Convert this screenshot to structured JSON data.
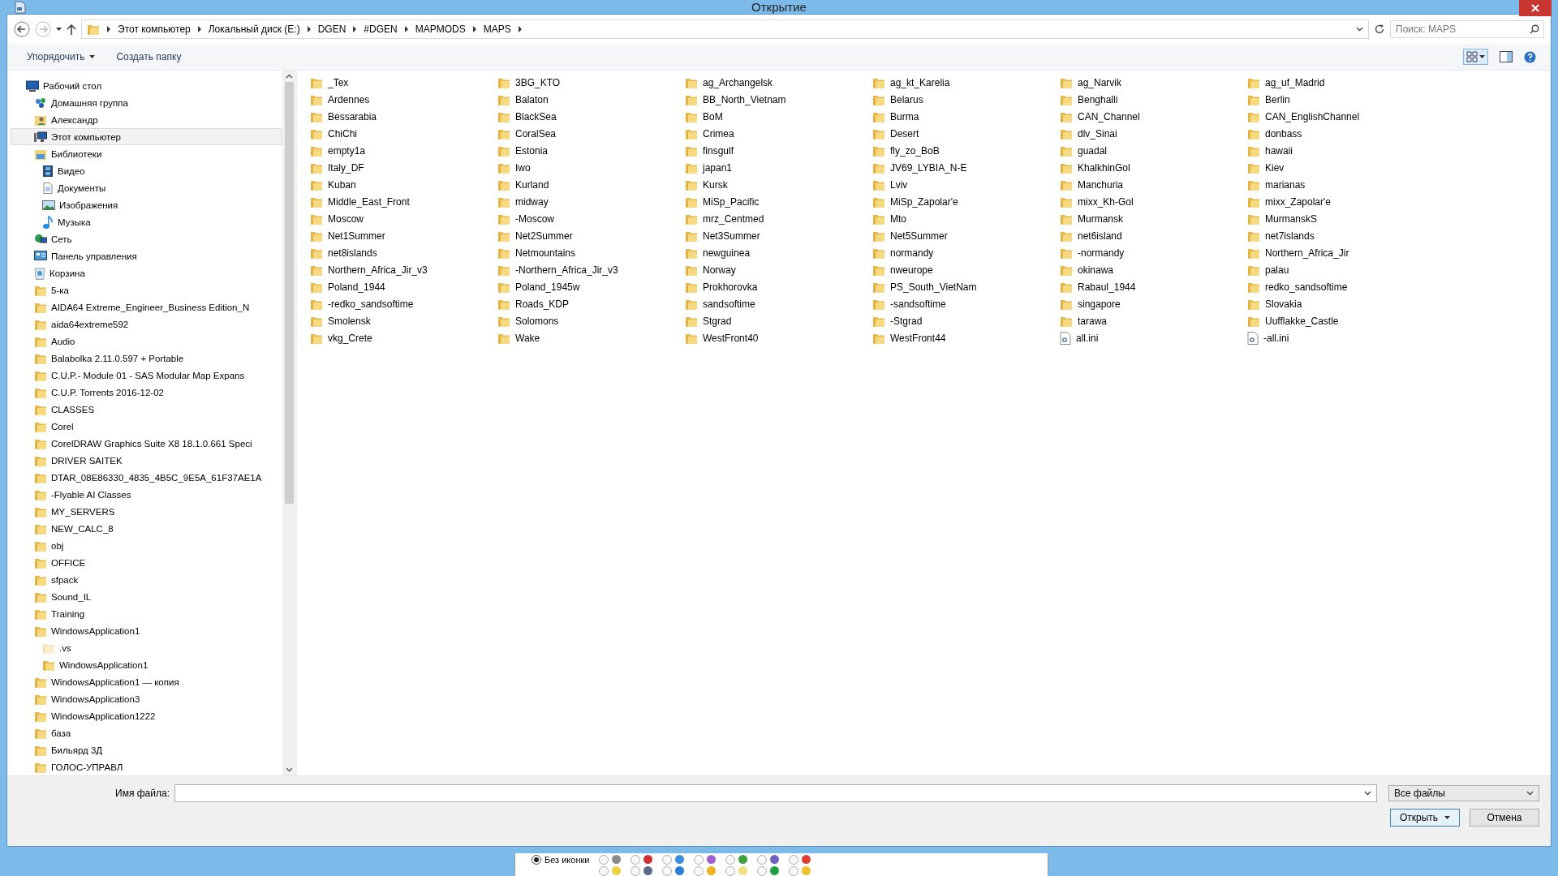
{
  "window": {
    "title": "Открытие"
  },
  "address_bar": {
    "path": [
      "Этот компьютер",
      "Локальный диск (E:)",
      "DGEN",
      "#DGEN",
      "MAPMODS",
      "MAPS"
    ],
    "search": {
      "placeholder": "Поиск: MAPS"
    }
  },
  "toolbar": {
    "buttons": [
      {
        "label": "Упорядочить",
        "kind": "menu"
      },
      {
        "label": "Создать папку",
        "kind": "plain"
      }
    ]
  },
  "sidebar": {
    "items": [
      {
        "label": "Рабочий стол",
        "kind": "desktop",
        "selected": false,
        "children": [
          {
            "label": "Домашняя группа",
            "kind": "homegroup",
            "selected": false
          },
          {
            "label": "Александр",
            "kind": "user",
            "selected": false
          },
          {
            "label": "Этот компьютер",
            "kind": "computer",
            "selected": true
          },
          {
            "label": "Библиотеки",
            "kind": "library",
            "selected": false,
            "children": [
              {
                "label": "Видео",
                "kind": "video",
                "selected": false
              },
              {
                "label": "Документы",
                "kind": "documents",
                "selected": false
              },
              {
                "label": "Изображения",
                "kind": "images",
                "selected": false
              },
              {
                "label": "Музыка",
                "kind": "music",
                "selected": false
              }
            ]
          },
          {
            "label": "Сеть",
            "kind": "network",
            "selected": false
          },
          {
            "label": "Панель управления",
            "kind": "control",
            "selected": false
          },
          {
            "label": "Корзина",
            "kind": "recycle",
            "selected": false
          },
          {
            "label": "5-ка",
            "kind": "folder",
            "selected": false
          },
          {
            "label": "AIDA64 Extreme_Engineer_Business Edition_N",
            "kind": "folder",
            "selected": false
          },
          {
            "label": "aida64extreme592",
            "kind": "folder",
            "selected": false
          },
          {
            "label": "Audio",
            "kind": "folder",
            "selected": false
          },
          {
            "label": "Balabolka 2.11.0.597 + Portable",
            "kind": "folder",
            "selected": false
          },
          {
            "label": "C.U.P.- Module 01 - SAS Modular Map Expans",
            "kind": "folder",
            "selected": false
          },
          {
            "label": "C.U.P. Torrents 2016-12-02",
            "kind": "folder",
            "selected": false
          },
          {
            "label": "CLASSES",
            "kind": "folder",
            "selected": false
          },
          {
            "label": "Corel",
            "kind": "folder",
            "selected": false
          },
          {
            "label": "CorelDRAW Graphics Suite X8 18.1.0.661 Speci",
            "kind": "folder",
            "selected": false
          },
          {
            "label": "DRIVER SAITEK",
            "kind": "folder",
            "selected": false
          },
          {
            "label": "DTAR_08E86330_4835_4B5C_9E5A_61F37AE1A",
            "kind": "folder",
            "selected": false
          },
          {
            "label": "-Flyable AI Classes",
            "kind": "folder",
            "selected": false
          },
          {
            "label": "MY_SERVERS",
            "kind": "folder",
            "selected": false
          },
          {
            "label": "NEW_CALC_8",
            "kind": "folder",
            "selected": false
          },
          {
            "label": "obj",
            "kind": "folder",
            "selected": false
          },
          {
            "label": "OFFICE",
            "kind": "folder",
            "selected": false
          },
          {
            "label": "sfpack",
            "kind": "folder",
            "selected": false
          },
          {
            "label": "Sound_IL",
            "kind": "folder",
            "selected": false
          },
          {
            "label": "Training",
            "kind": "folder",
            "selected": false
          },
          {
            "label": "WindowsApplication1",
            "kind": "folder",
            "selected": false,
            "children": [
              {
                "label": ".vs",
                "kind": "hidden-folder",
                "selected": false
              },
              {
                "label": "WindowsApplication1",
                "kind": "folder",
                "selected": false
              }
            ]
          },
          {
            "label": "WindowsApplication1 — копия",
            "kind": "folder",
            "selected": false
          },
          {
            "label": "WindowsApplication3",
            "kind": "folder",
            "selected": false
          },
          {
            "label": "WindowsApplication1222",
            "kind": "folder",
            "selected": false
          },
          {
            "label": "база",
            "kind": "folder",
            "selected": false
          },
          {
            "label": "Бильярд 3Д",
            "kind": "folder",
            "selected": false
          },
          {
            "label": "ГОЛОС-УПРАВЛ",
            "kind": "folder",
            "selected": false
          }
        ]
      }
    ]
  },
  "files": [
    {
      "name": "_Tex",
      "kind": "folder"
    },
    {
      "name": "Ardennes",
      "kind": "folder"
    },
    {
      "name": "Bessarabia",
      "kind": "folder"
    },
    {
      "name": "ChiChi",
      "kind": "folder"
    },
    {
      "name": "empty1a",
      "kind": "folder"
    },
    {
      "name": "Italy_DF",
      "kind": "folder"
    },
    {
      "name": "Kuban",
      "kind": "folder"
    },
    {
      "name": "Middle_East_Front",
      "kind": "folder"
    },
    {
      "name": "Moscow",
      "kind": "folder"
    },
    {
      "name": "Net1Summer",
      "kind": "folder"
    },
    {
      "name": "net8islands",
      "kind": "folder"
    },
    {
      "name": "Northern_Africa_Jir_v3",
      "kind": "folder"
    },
    {
      "name": "Poland_1944",
      "kind": "folder"
    },
    {
      "name": "-redko_sandsoftime",
      "kind": "folder"
    },
    {
      "name": "Smolensk",
      "kind": "folder"
    },
    {
      "name": "vkg_Crete",
      "kind": "folder"
    },
    {
      "name": "3BG_KTO",
      "kind": "folder"
    },
    {
      "name": "Balaton",
      "kind": "folder"
    },
    {
      "name": "BlackSea",
      "kind": "folder"
    },
    {
      "name": "CoralSea",
      "kind": "folder"
    },
    {
      "name": "Estonia",
      "kind": "folder"
    },
    {
      "name": "Iwo",
      "kind": "folder"
    },
    {
      "name": "Kurland",
      "kind": "folder"
    },
    {
      "name": "midway",
      "kind": "folder"
    },
    {
      "name": "-Moscow",
      "kind": "folder"
    },
    {
      "name": "Net2Summer",
      "kind": "folder"
    },
    {
      "name": "Netmountains",
      "kind": "folder"
    },
    {
      "name": "-Northern_Africa_Jir_v3",
      "kind": "folder"
    },
    {
      "name": "Poland_1945w",
      "kind": "folder"
    },
    {
      "name": "Roads_KDP",
      "kind": "folder"
    },
    {
      "name": "Solomons",
      "kind": "folder"
    },
    {
      "name": "Wake",
      "kind": "folder"
    },
    {
      "name": "ag_Archangelsk",
      "kind": "folder"
    },
    {
      "name": "BB_North_Vietnam",
      "kind": "folder"
    },
    {
      "name": "BoM",
      "kind": "folder"
    },
    {
      "name": "Crimea",
      "kind": "folder"
    },
    {
      "name": "finsgulf",
      "kind": "folder"
    },
    {
      "name": "japan1",
      "kind": "folder"
    },
    {
      "name": "Kursk",
      "kind": "folder"
    },
    {
      "name": "MiSp_Pacific",
      "kind": "folder"
    },
    {
      "name": "mrz_Centmed",
      "kind": "folder"
    },
    {
      "name": "Net3Summer",
      "kind": "folder"
    },
    {
      "name": "newguinea",
      "kind": "folder"
    },
    {
      "name": "Norway",
      "kind": "folder"
    },
    {
      "name": "Prokhorovka",
      "kind": "folder"
    },
    {
      "name": "sandsoftime",
      "kind": "folder"
    },
    {
      "name": "Stgrad",
      "kind": "folder"
    },
    {
      "name": "WestFront40",
      "kind": "folder"
    },
    {
      "name": "ag_kt_Karelia",
      "kind": "folder"
    },
    {
      "name": "Belarus",
      "kind": "folder"
    },
    {
      "name": "Burma",
      "kind": "folder"
    },
    {
      "name": "Desert",
      "kind": "folder"
    },
    {
      "name": "fly_zo_BoB",
      "kind": "folder"
    },
    {
      "name": "JV69_LYBIA_N-E",
      "kind": "folder"
    },
    {
      "name": "Lviv",
      "kind": "folder"
    },
    {
      "name": "MiSp_Zapolar'e",
      "kind": "folder"
    },
    {
      "name": "Mto",
      "kind": "folder"
    },
    {
      "name": "Net5Summer",
      "kind": "folder"
    },
    {
      "name": "normandy",
      "kind": "folder"
    },
    {
      "name": "nweurope",
      "kind": "folder"
    },
    {
      "name": "PS_South_VietNam",
      "kind": "folder"
    },
    {
      "name": "-sandsoftime",
      "kind": "folder"
    },
    {
      "name": "-Stgrad",
      "kind": "folder"
    },
    {
      "name": "WestFront44",
      "kind": "folder"
    },
    {
      "name": "ag_Narvik",
      "kind": "folder"
    },
    {
      "name": "Benghalli",
      "kind": "folder"
    },
    {
      "name": "CAN_Channel",
      "kind": "folder"
    },
    {
      "name": "dlv_Sinai",
      "kind": "folder"
    },
    {
      "name": "guadal",
      "kind": "folder"
    },
    {
      "name": "KhalkhinGol",
      "kind": "folder"
    },
    {
      "name": "Manchuria",
      "kind": "folder"
    },
    {
      "name": "mixx_Kh-Gol",
      "kind": "folder"
    },
    {
      "name": "Murmansk",
      "kind": "folder"
    },
    {
      "name": "net6island",
      "kind": "folder"
    },
    {
      "name": "-normandy",
      "kind": "folder"
    },
    {
      "name": "okinawa",
      "kind": "folder"
    },
    {
      "name": "Rabaul_1944",
      "kind": "folder"
    },
    {
      "name": "singapore",
      "kind": "folder"
    },
    {
      "name": "tarawa",
      "kind": "folder"
    },
    {
      "name": "all.ini",
      "kind": "ini"
    },
    {
      "name": "ag_uf_Madrid",
      "kind": "folder"
    },
    {
      "name": "Berlin",
      "kind": "folder"
    },
    {
      "name": "CAN_EnglishChannel",
      "kind": "folder"
    },
    {
      "name": "donbass",
      "kind": "folder"
    },
    {
      "name": "hawaii",
      "kind": "folder"
    },
    {
      "name": "Kiev",
      "kind": "folder"
    },
    {
      "name": "marianas",
      "kind": "folder"
    },
    {
      "name": "mixx_Zapolar'e",
      "kind": "folder"
    },
    {
      "name": "MurmanskS",
      "kind": "folder"
    },
    {
      "name": "net7islands",
      "kind": "folder"
    },
    {
      "name": "Northern_Africa_Jir",
      "kind": "folder"
    },
    {
      "name": "palau",
      "kind": "folder"
    },
    {
      "name": "redko_sandsoftime",
      "kind": "folder"
    },
    {
      "name": "Slovakia",
      "kind": "folder"
    },
    {
      "name": "Uufflakke_Castle",
      "kind": "folder"
    },
    {
      "name": "-all.ini",
      "kind": "ini"
    }
  ],
  "file_name": {
    "label": "Имя файла:"
  },
  "file_type": {
    "value": "Все файлы"
  },
  "buttons": [
    {
      "label": "Открыть",
      "kind": "split"
    },
    {
      "label": "Отмена",
      "kind": "plain"
    }
  ],
  "background_window": {
    "label": "Без иконки",
    "selected": true,
    "options": [
      {
        "selected": false,
        "color": "#8a8a8a"
      },
      {
        "selected": false,
        "color": "#f0d040"
      },
      {
        "selected": false,
        "color": "#d03030"
      },
      {
        "selected": false,
        "color": "#5a6a8a"
      },
      {
        "selected": false,
        "color": "#3a8fe0"
      },
      {
        "selected": false,
        "color": "#2a80d8"
      },
      {
        "selected": false,
        "color": "#a060d0"
      },
      {
        "selected": false,
        "color": "#f0b020"
      },
      {
        "selected": false,
        "color": "#40a040"
      },
      {
        "selected": false,
        "color": "#f0e080"
      },
      {
        "selected": false,
        "color": "#7060c0"
      },
      {
        "selected": false,
        "color": "#20a040"
      },
      {
        "selected": false,
        "color": "#e04030"
      },
      {
        "selected": false,
        "color": "#f0c030"
      }
    ]
  }
}
